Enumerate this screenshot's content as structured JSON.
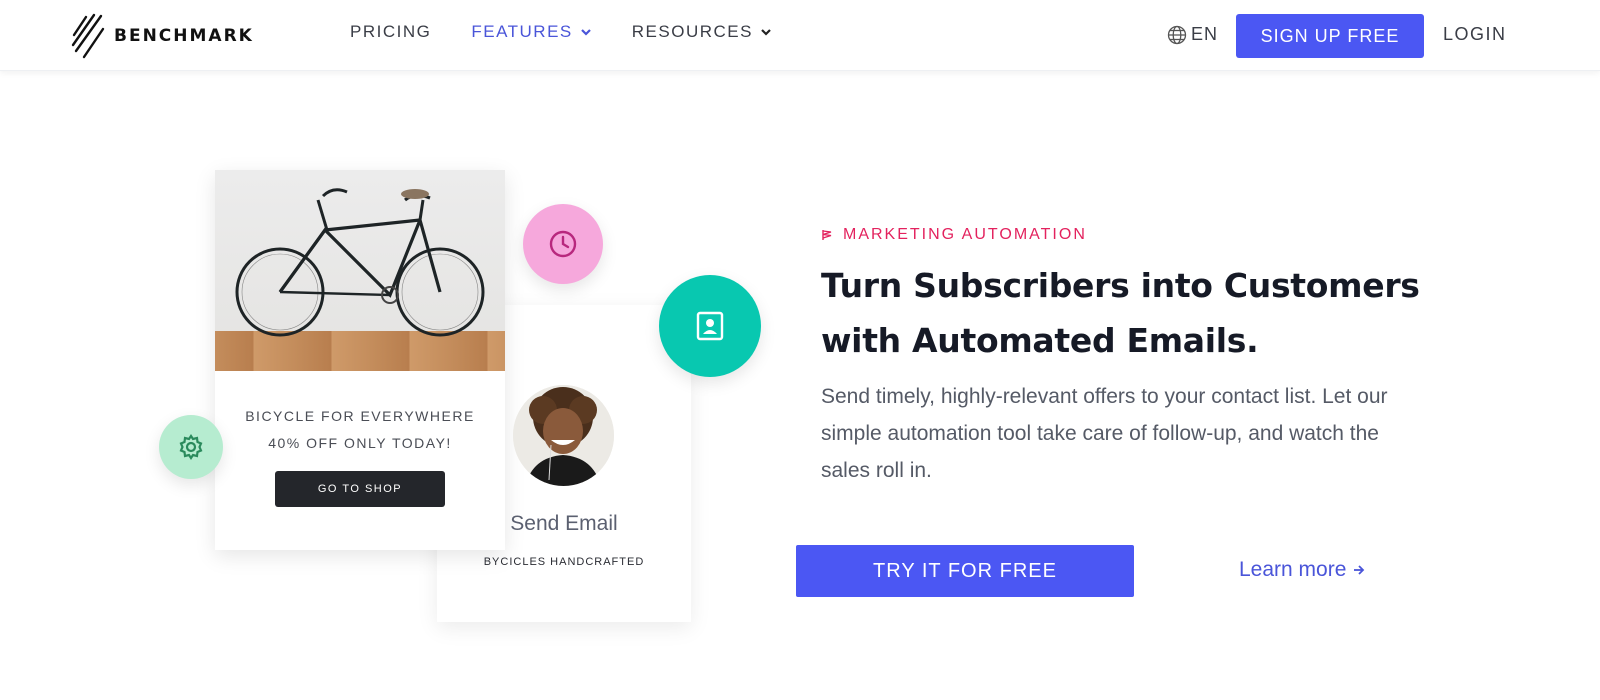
{
  "header": {
    "logo_text": "BENCHMARK",
    "nav": [
      {
        "label": "PRICING"
      },
      {
        "label": "FEATURES"
      },
      {
        "label": "RESOURCES"
      }
    ],
    "lang": "EN",
    "signup_label": "SIGN UP FREE",
    "login_label": "LOGIN"
  },
  "illustration": {
    "promo_line1": "BICYCLE FOR EVERYWHERE",
    "promo_line2": "40% OFF ONLY TODAY!",
    "shop_button": "GO TO SHOP",
    "send_email": "Send Email",
    "tagline": "BYCICLES HANDCRAFTED"
  },
  "hero": {
    "eyebrow": "MARKETING AUTOMATION",
    "headline": "Turn Subscribers into Customers with Automated Emails.",
    "description": "Send timely, highly-relevant offers to your contact list. Let our simple automation tool take care of follow-up, and watch the sales roll in.",
    "cta_label": "TRY IT FOR FREE",
    "learn_more": "Learn more"
  },
  "colors": {
    "accent": "#4b57f3",
    "eyebrow": "#e3225e",
    "clock_circle": "#f6a8dc",
    "contact_circle": "#08c8b0",
    "gear_circle": "#b6ecd0"
  }
}
